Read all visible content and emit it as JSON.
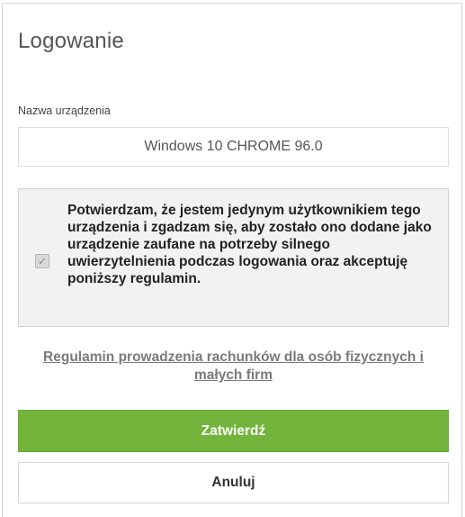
{
  "header": {
    "title": "Logowanie"
  },
  "device": {
    "label": "Nazwa urządzenia",
    "value": "Windows 10 CHROME 96.0"
  },
  "consent": {
    "checked": true,
    "checkbox_icon": "check-icon",
    "text": "Potwierdzam, że jestem jedynym użytkownikiem tego urządzenia i zgadzam się, aby zostało ono dodane jako urządzenie zaufane na potrzeby silnego uwierzytelnienia podczas logowania oraz akceptuję poniższy regulamin."
  },
  "terms": {
    "link_text": "Regulamin prowadzenia rachunków dla osób fizycznych i małych firm"
  },
  "actions": {
    "submit_label": "Zatwierdź",
    "cancel_label": "Anuluj"
  },
  "colors": {
    "submit_button": "#73b43c",
    "consent_background": "#f2f2f2",
    "title_text": "#555555"
  }
}
